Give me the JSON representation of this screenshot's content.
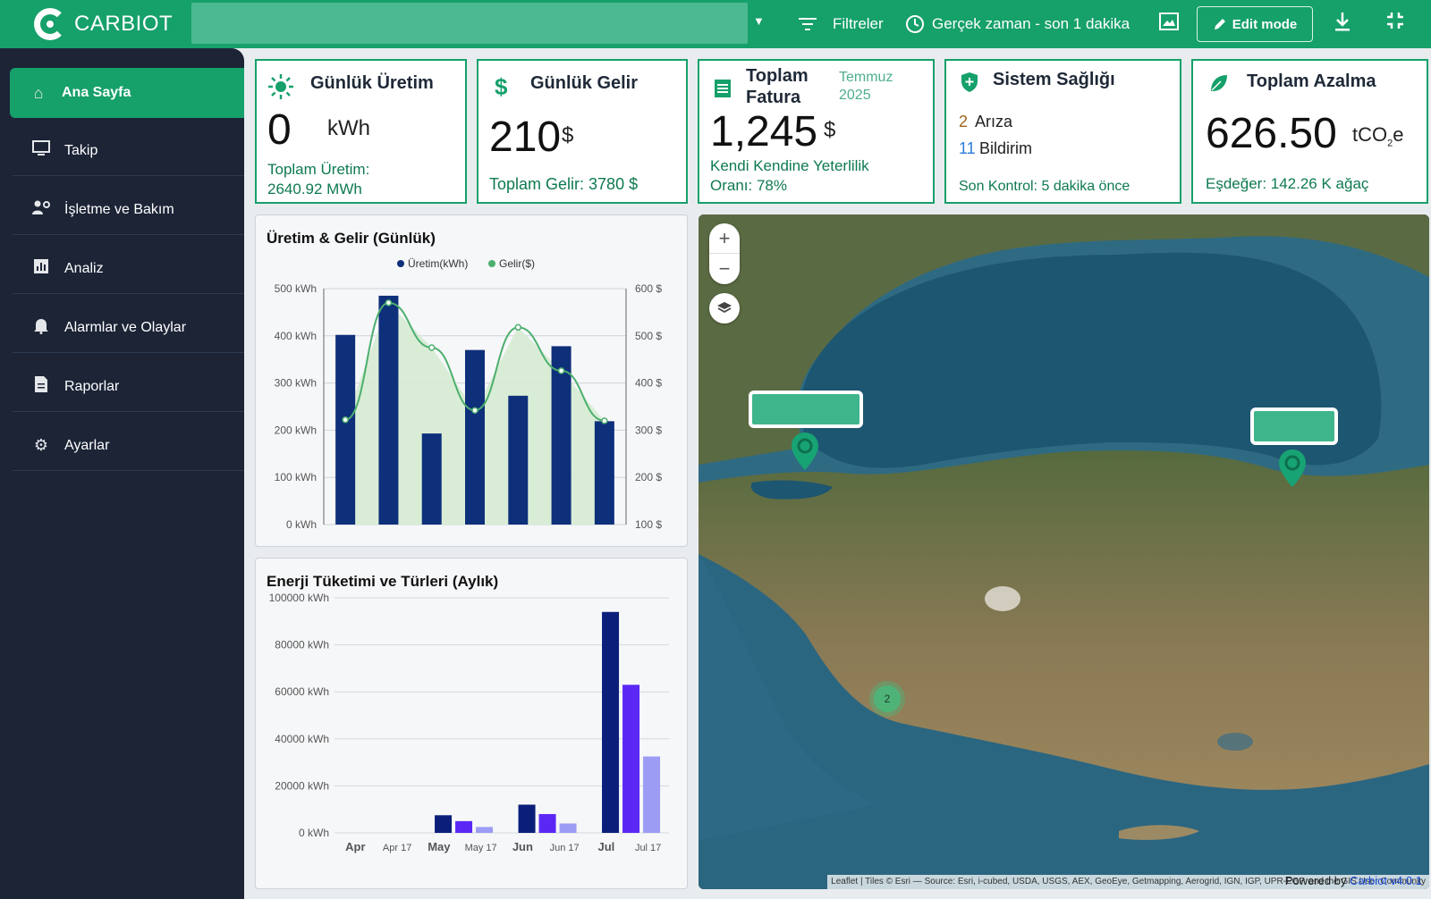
{
  "header": {
    "brand": "CARBIOT",
    "filters_label": "Filtreler",
    "time_label": "Gerçek zaman - son 1 dakika",
    "edit_label": "Edit mode"
  },
  "sidebar": {
    "items": [
      {
        "label": "Ana Sayfa",
        "icon": "home-icon"
      },
      {
        "label": "Takip",
        "icon": "monitor-icon"
      },
      {
        "label": "İşletme ve Bakım",
        "icon": "users-gear-icon"
      },
      {
        "label": "Analiz",
        "icon": "bar-chart-icon"
      },
      {
        "label": "Alarmlar ve Olaylar",
        "icon": "bell-icon"
      },
      {
        "label": "Raporlar",
        "icon": "report-icon"
      },
      {
        "label": "Ayarlar",
        "icon": "gear-icon"
      }
    ]
  },
  "kpis": {
    "daily_production": {
      "title": "Günlük Üretim",
      "value": "0",
      "unit": "kWh",
      "sub1": "Toplam Üretim:",
      "sub2": "2640.92 MWh"
    },
    "daily_revenue": {
      "title": "Günlük Gelir",
      "value": "210",
      "unit": "$",
      "sub": "Toplam Gelir: 3780 $"
    },
    "total_invoice": {
      "title1": "Toplam",
      "title2": "Fatura",
      "period1": "Temmuz",
      "period2": "2025",
      "value": "1,245",
      "unit": "$",
      "sub1": "Kendi Kendine Yeterlilik",
      "sub2": "Oranı: 78%"
    },
    "system_health": {
      "title": "Sistem Sağlığı",
      "faults_count": "2",
      "faults_label": "Arıza",
      "notif_count": "11",
      "notif_label": "Bildirim",
      "last_check": "Son Kontrol: 5 dakika önce"
    },
    "total_reduction": {
      "title": "Toplam Azalma",
      "value": "626.50",
      "unit_main": "tCO",
      "unit_sub": "2",
      "unit_end": "e",
      "sub": "Eşdeğer: 142.26 K ağaç"
    }
  },
  "panels": {
    "daily_chart_title": "Üretim & Gelir (Günlük)",
    "monthly_chart_title": "Enerji Tüketimi ve Türleri (Aylık)"
  },
  "chart_data": [
    {
      "type": "bar",
      "title": "Üretim & Gelir (Günlük)",
      "legend": [
        "Üretim(kWh)",
        "Gelir($)"
      ],
      "legend_placement": "top-center",
      "series": [
        {
          "name": "Üretim(kWh)",
          "type": "bar",
          "axis": "left",
          "values": [
            402,
            485,
            193,
            370,
            273,
            378,
            219
          ]
        },
        {
          "name": "Gelir($)",
          "type": "area",
          "axis": "right",
          "values": [
            322,
            570,
            475,
            342,
            518,
            426,
            320
          ]
        }
      ],
      "y_left": {
        "ticks": [
          "500 kWh",
          "400 kWh",
          "300 kWh",
          "200 kWh",
          "100 kWh",
          "0 kWh"
        ],
        "range": [
          0,
          500
        ]
      },
      "y_right": {
        "ticks": [
          "600 $",
          "500 $",
          "400 $",
          "300 $",
          "200 $",
          "100 $"
        ],
        "range": [
          100,
          600
        ]
      },
      "colors": {
        "bar": "#0e2f7a",
        "line": "#4caf6e",
        "area": "#d6ebd2"
      },
      "grid": true
    },
    {
      "type": "bar",
      "title": "Enerji Tüketimi ve Türleri (Aylık)",
      "categories": [
        "Apr",
        "May",
        "Jun",
        "Jul"
      ],
      "x_ticks": [
        "Apr",
        "Apr 17",
        "May",
        "May 17",
        "Jun",
        "Jun 17",
        "Jul",
        "Jul 17"
      ],
      "series": [
        {
          "color": "#0b1f7a",
          "values": [
            0,
            7500,
            12000,
            94000
          ]
        },
        {
          "color": "#5b27f5",
          "values": [
            0,
            5000,
            8000,
            63000
          ]
        },
        {
          "color": "#9c9cf5",
          "values": [
            0,
            2500,
            4000,
            32500
          ]
        }
      ],
      "y_ticks": [
        "100000 kWh",
        "80000 kWh",
        "60000 kWh",
        "40000 kWh",
        "20000 kWh",
        "0 kWh"
      ],
      "ylim": [
        0,
        100000
      ],
      "grid": true
    }
  ],
  "map": {
    "zoom_in": "+",
    "zoom_out": "−",
    "cluster_count": "2",
    "attribution": "Leaflet | Tiles © Esri — Source: Esri, i-cubed, USDA, USGS, AEX, GeoEye, Getmapping, Aerogrid, IGN, IGP, UPR-EGP, and the GIS User Community",
    "powered_prefix": "Powered by",
    "powered_brand": "Carbiot v4.0.1"
  }
}
